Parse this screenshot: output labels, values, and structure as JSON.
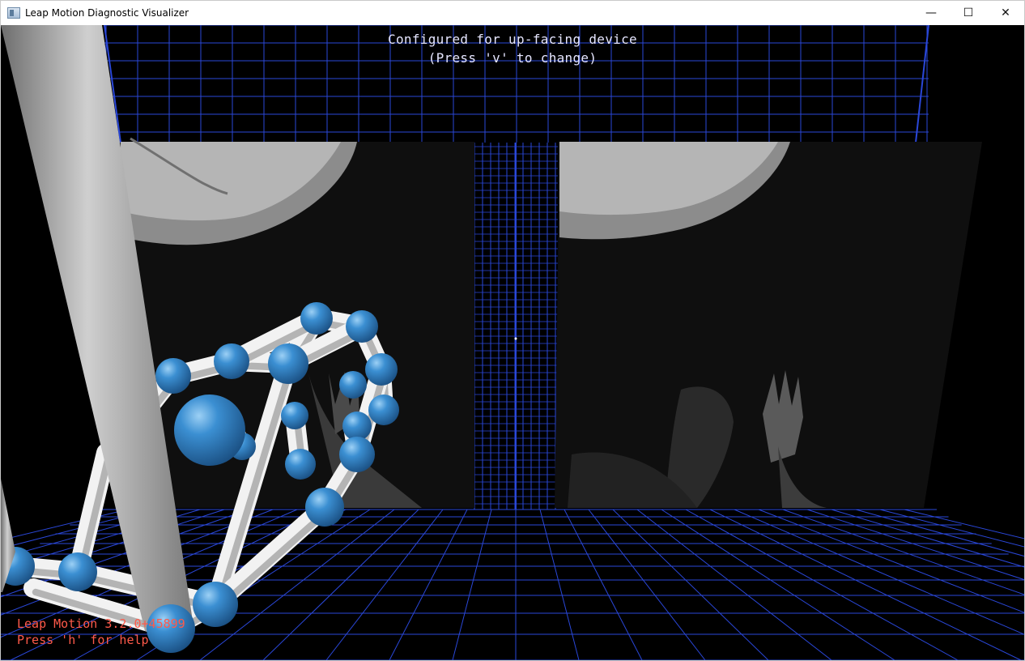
{
  "window": {
    "title": "Leap Motion Diagnostic Visualizer",
    "controls": {
      "minimize": "—",
      "maximize": "☐",
      "close": "✕"
    }
  },
  "overlay": {
    "config_line1": "Configured for up-facing device",
    "config_line2": "(Press 'v' to change)",
    "version_line": "Leap Motion 3.2.0+45899",
    "help_line": "Press 'h' for help"
  },
  "colors": {
    "grid": "#2a47d8",
    "joint": "#2f7fc4",
    "bone": "#eeeeee",
    "version_text": "#ff5a4a",
    "status_text": "#e6e6ff"
  }
}
